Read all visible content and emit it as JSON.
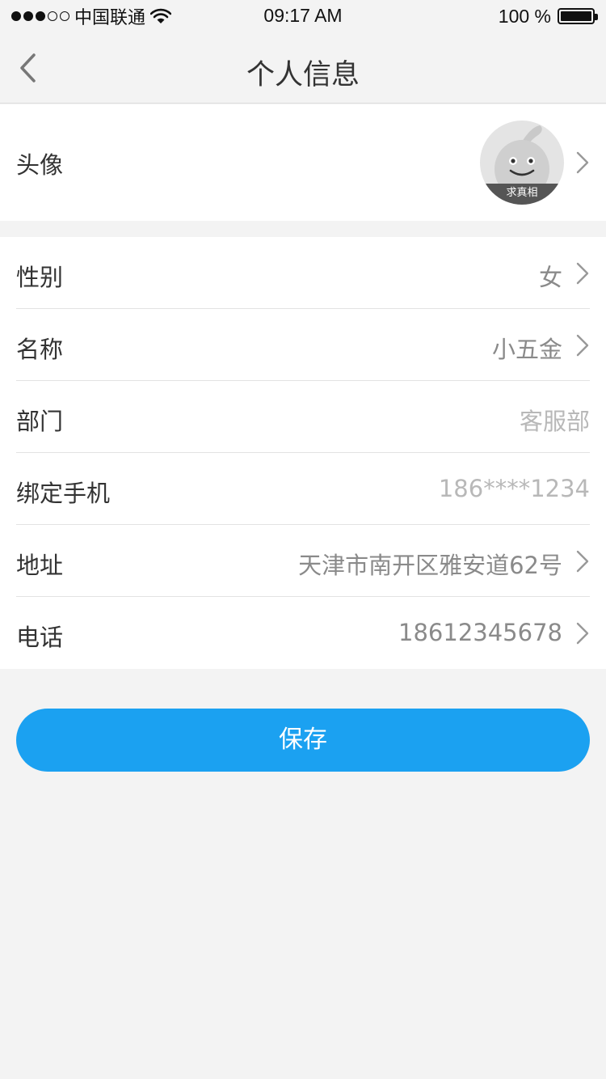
{
  "status_bar": {
    "carrier": "中国联通",
    "time": "09:17 AM",
    "battery": "100 %"
  },
  "nav": {
    "title": "个人信息",
    "back_icon": "chevron-left-icon"
  },
  "avatar_row": {
    "label": "头像",
    "caption": "求真相"
  },
  "rows": [
    {
      "label": "性别",
      "value": "女",
      "has_arrow": true
    },
    {
      "label": "名称",
      "value": "小五金",
      "has_arrow": true
    },
    {
      "label": "部门",
      "value": "客服部",
      "has_arrow": false
    },
    {
      "label": "绑定手机",
      "value": "186****1234",
      "has_arrow": false
    },
    {
      "label": "地址",
      "value": "天津市南开区雅安道62号",
      "has_arrow": true
    },
    {
      "label": "电话",
      "value": "18612345678",
      "has_arrow": true
    }
  ],
  "save_button": {
    "label": "保存"
  },
  "colors": {
    "accent": "#1ba1f1",
    "background": "#f3f3f3",
    "value_text": "#8a8a8a",
    "muted_value_text": "#b8b8b8"
  }
}
